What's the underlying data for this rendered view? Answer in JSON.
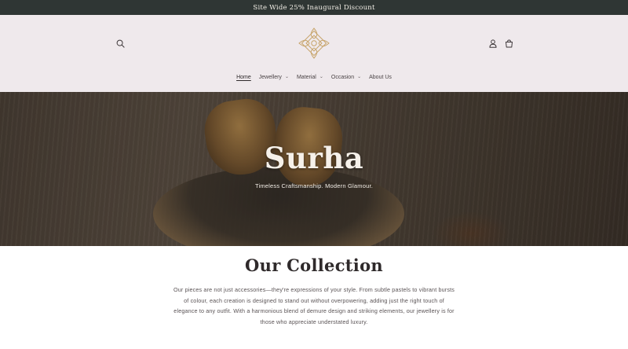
{
  "announcement": {
    "text": "Site Wide 25% Inaugural Discount"
  },
  "header": {
    "icons": {
      "search": "search-icon",
      "account": "account-icon",
      "cart": "cart-icon",
      "logo": "surha-logo"
    },
    "colors": {
      "background": "#efe9ec",
      "logo_gold": "#c7a46a"
    }
  },
  "nav": {
    "items": [
      {
        "label": "Home",
        "active": true,
        "has_dropdown": false
      },
      {
        "label": "Jewellery",
        "has_dropdown": true
      },
      {
        "label": "Material",
        "has_dropdown": true
      },
      {
        "label": "Occasion",
        "has_dropdown": true
      },
      {
        "label": "About Us",
        "has_dropdown": false
      }
    ],
    "dropdown_glyph": "⌄"
  },
  "hero": {
    "title": "Surha",
    "subtitle": "Timeless Craftsmanship. Modern Glamour."
  },
  "collection": {
    "title": "Our Collection",
    "description": "Our pieces are not just accessories—they're expressions of your style. From subtle pastels to vibrant bursts of colour, each creation is designed to stand out without overpowering, adding just the right touch of elegance to any outfit. With a harmonious blend of demure design and striking elements, our jewellery is for those who appreciate understated luxury."
  }
}
